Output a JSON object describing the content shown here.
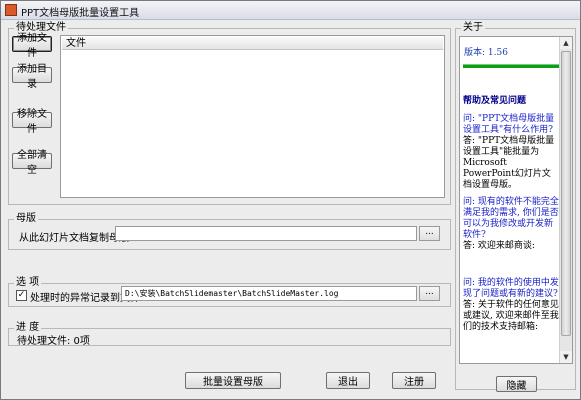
{
  "window": {
    "title": "PPT文档母版批量设置工具"
  },
  "files_group": {
    "label": "待处理文件",
    "buttons": {
      "add_file": "添加文件",
      "add_dir": "添加目录",
      "remove_file": "移除文件",
      "clear_all": "全部清空"
    },
    "column_header": "文件"
  },
  "master_group": {
    "label": "母版",
    "copy_label": "从此幻灯片文档复制母版:",
    "path_value": "",
    "browse": "..."
  },
  "options_group": {
    "label": "选  项",
    "log_checkbox_checked": true,
    "checkmark": "✓",
    "log_label": "处理时的异常记录到文件:",
    "log_path": "D:\\安装\\BatchSlidemaster\\BatchSlideMaster.log",
    "browse": "..."
  },
  "progress_group": {
    "label": "进  度",
    "pending_text": "待处理文件: 0项"
  },
  "bottom_buttons": {
    "batch_set": "批量设置母版",
    "exit": "退出",
    "register": "注册"
  },
  "about": {
    "label": "关于",
    "version": "版本: 1.56",
    "help_title": "帮助及常见问题",
    "faq": [
      {
        "q": "问: \"PPT文档母版批量设置工具\"有什么作用?",
        "a": "答: \"PPT文档母版批量设置工具\"能批量为Microsoft PowerPoint幻灯片文档设置母版。"
      },
      {
        "q": "问: 现有的软件不能完全满足我的需求, 你们是否可以为我修改或开发新软件?",
        "a": "答: 欢迎来邮商谈:"
      },
      {
        "q": "问: 我的软件的使用中发现了问题或有新的建议?",
        "a": "答: 关于软件的任何意见或建议, 欢迎来邮件至我们的技术支持邮箱:"
      }
    ],
    "hide_button": "隐藏"
  }
}
